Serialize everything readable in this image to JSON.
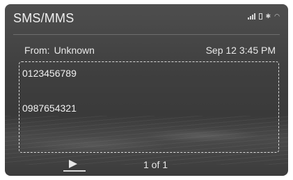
{
  "header": {
    "title": "SMS/MMS",
    "status_icons": [
      "signal-icon",
      "battery-icon",
      "bluetooth-icon",
      "wifi-icon"
    ]
  },
  "message": {
    "from_label": "From:",
    "from_value": "Unknown",
    "timestamp": "Sep 12 3:45 PM",
    "lines": [
      "0123456789",
      "0987654321"
    ]
  },
  "footer": {
    "play_icon": "play-icon",
    "page_indicator": "1 of 1"
  },
  "colors": {
    "background": "#444444",
    "text": "#e6e6e6",
    "dashed_border": "#d9d9d9"
  }
}
